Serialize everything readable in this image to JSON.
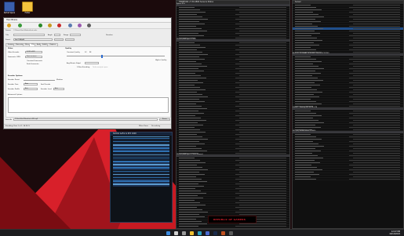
{
  "desktop": {
    "icons": [
      {
        "label": "Kerbal Space"
      },
      {
        "label": "Folder"
      }
    ]
  },
  "handbrake": {
    "title": "HandBrake",
    "source_label": "Source",
    "source_value": "C:\\Users\\User\\Videos\\test.mkv",
    "title_label": "Title",
    "angle_label": "Angle",
    "range_label": "Range",
    "chapters_label": "Chapters",
    "duration_label": "Duration",
    "preset_label": "Preset",
    "preset_value": "Fast 1080p30",
    "tabs": [
      "Summary",
      "Dimensions",
      "Filters",
      "Video",
      "Audio",
      "Subtitles",
      "Chapters"
    ],
    "video_label": "Video",
    "encoder_label": "Video Encoder",
    "encoder_value": "H.265 (x265)",
    "framerate_label": "Framerate (FPS)",
    "framerate_value": "Same as source",
    "cfr_label": "Constant Framerate",
    "pfr_label": "Peak Framerate",
    "quality_label": "Quality",
    "cq_label": "Constant Quality",
    "cq_value": "22",
    "rf_label": "RF",
    "higher_label": "Higher Quality",
    "bitrate_label": "Avg Bitrate (kbps)",
    "multipass_label": "2-Pass Encoding",
    "turbo_label": "Turbo analysis pass",
    "encoder_options_label": "Encoder Options",
    "preset_opt_label": "Encoder Preset",
    "preset_opt_value": "Medium",
    "tune_label": "Encoder Tune",
    "tune_value": "None",
    "profile_label": "Encoder Profile",
    "profile_value": "Auto",
    "level_label": "Encoder Level",
    "level_value": "Auto",
    "fast_decode_label": "Fast Decode",
    "advanced_label": "Advanced Options",
    "save_as_label": "Save As",
    "save_as_value": "C:\\Users\\User\\Videos\\test-x265.mp4",
    "browse_label": "Browse",
    "status": "Encoding: Pass 1 of 1, 34.28 %",
    "when_done_label": "When Done:",
    "when_done_value": "Do nothing"
  },
  "hwinfo": {
    "title": "HWiNFO64 v7.30-4800 Sensors Status",
    "col_sensor": "Sensor",
    "col_current": "Current",
    "col_min": "Minimum",
    "col_max": "Maximum",
    "col_avg": "Average",
    "sections_left": [
      "System: ROG",
      "CPU [#0]: AMD Ryzen 9 7950X",
      "CPU [#0]: AMD Ryzen 9 7950X: Enhanced"
    ],
    "sections_right": [
      "ASUS ROG CROSSHAIR X670E HERO (Nuvoton NCT6799D)",
      "S.M.A.R.T.: Samsung SSD 980 PRO 2TB",
      "GPU [#0]: NVIDIA GeForce RTX 4090"
    ],
    "brand": "REPUBLIC OF GAMERS"
  },
  "gpuz": {
    "title": "NVIDIA GeForce RTX 4090"
  },
  "taskbar": {
    "time": "12:47 PM",
    "date": "10/14/2022"
  }
}
